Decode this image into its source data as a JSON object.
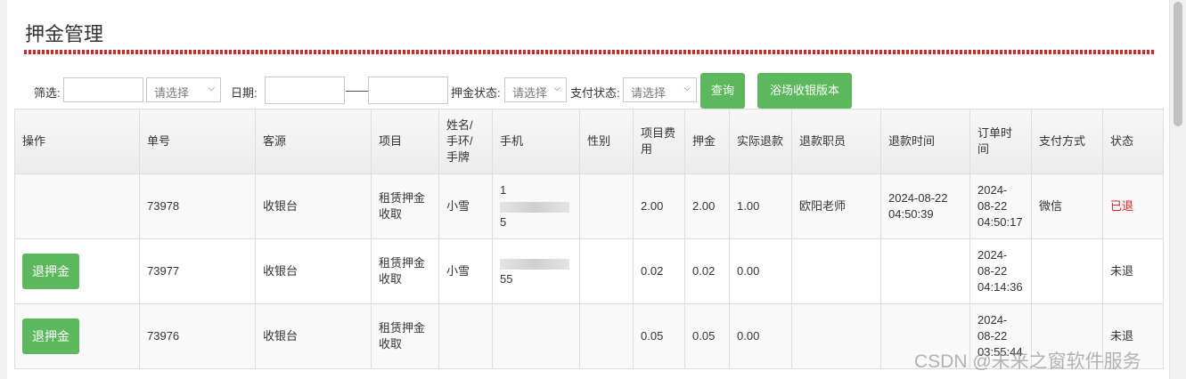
{
  "title": "押金管理",
  "filters": {
    "filter_label": "筛选:",
    "filter_select": "请选择",
    "date_label": "日期:",
    "date_sep": "——",
    "deposit_status_label": "押金状态:",
    "deposit_status_select": "请选择",
    "pay_status_label": "支付状态:",
    "pay_status_select": "请选择",
    "query_button": "查询",
    "version_button": "浴场收银版本"
  },
  "table": {
    "headers": [
      "操作",
      "单号",
      "客源",
      "项目",
      "姓名/\n手环/\n手牌",
      "手机",
      "性别",
      "项目费\n用",
      "押金",
      "实际退款",
      "退款职员",
      "退款时间",
      "订单时\n间",
      "支付方式",
      "状态"
    ],
    "rows": [
      {
        "action": "",
        "order_no": "73978",
        "source": "收银台",
        "item": "租赁押金\n收取",
        "name": "小雪",
        "phone_prefix": "1",
        "phone_suffix": "5",
        "gender": "",
        "fee": "2.00",
        "deposit": "2.00",
        "refund": "1.00",
        "staff": "欧阳老师",
        "refund_time": "2024-08-22\n04:50:39",
        "order_time": "2024-\n08-22\n04:50:17",
        "pay_method": "微信",
        "status": "已退",
        "status_color": "#e02020"
      },
      {
        "action": "退押金",
        "order_no": "73977",
        "source": "收银台",
        "item": "租赁押金\n收取",
        "name": "小雪",
        "phone_prefix": "",
        "phone_suffix": "55",
        "gender": "",
        "fee": "0.02",
        "deposit": "0.02",
        "refund": "0.00",
        "staff": "",
        "refund_time": "",
        "order_time": "2024-\n08-22\n04:14:36",
        "pay_method": "",
        "status": "未退",
        "status_color": "#333333"
      },
      {
        "action": "退押金",
        "order_no": "73976",
        "source": "收银台",
        "item": "租赁押金\n收取",
        "name": "",
        "phone_prefix": "",
        "phone_suffix": "",
        "gender": "",
        "fee": "0.05",
        "deposit": "0.05",
        "refund": "0.00",
        "staff": "",
        "refund_time": "",
        "order_time": "2024-\n08-22\n03:55:44",
        "pay_method": "",
        "status": "未退",
        "status_color": "#333333"
      }
    ]
  },
  "watermark": "CSDN @未来之窗软件服务",
  "colors": {
    "accent_green": "#5cb85c",
    "title_rule_red": "#e02020"
  }
}
